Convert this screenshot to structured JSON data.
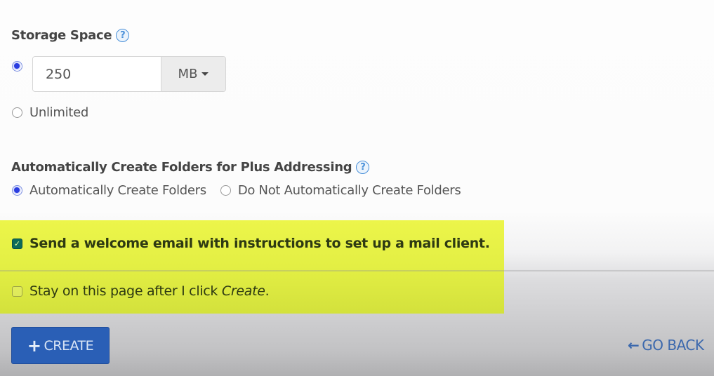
{
  "storage": {
    "title": "Storage Space",
    "help_icon": "question-circle-icon",
    "options": [
      {
        "label": "",
        "selected": true
      },
      {
        "label": "Unlimited",
        "selected": false
      }
    ],
    "value": "250",
    "unit": "MB"
  },
  "plus_addressing": {
    "title": "Automatically Create Folders for Plus Addressing",
    "help_icon": "question-circle-icon",
    "options": [
      {
        "label": "Automatically Create Folders",
        "selected": true
      },
      {
        "label": "Do Not Automatically Create Folders",
        "selected": false
      }
    ]
  },
  "checkboxes": [
    {
      "label": "Send a welcome email with instructions to set up a mail client.",
      "checked": true
    },
    {
      "label_prefix": "Stay on this page after I click ",
      "label_emphasis": "Create",
      "label_suffix": ".",
      "checked": false
    }
  ],
  "actions": {
    "create_icon": "plus-icon",
    "create_label": "CREATE",
    "go_back_icon": "arrow-left-icon",
    "go_back_label": "GO BACK"
  },
  "colors": {
    "highlight": "#e6f046",
    "primary_button": "#2a5fb6",
    "link": "#3b68ad",
    "radio_selected": "#2a3de0",
    "checkbox_checked": "#0d6a5a"
  }
}
